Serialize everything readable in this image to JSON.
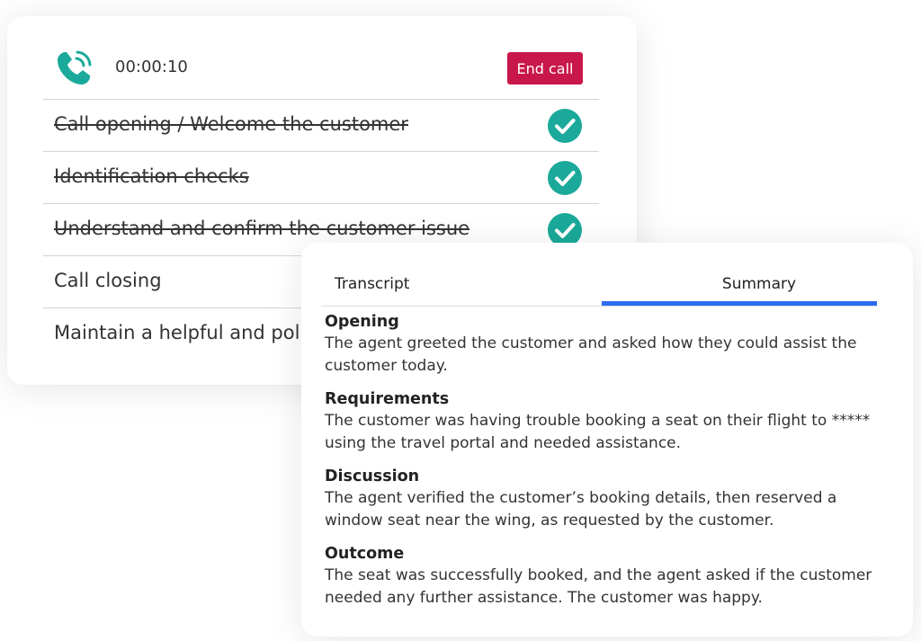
{
  "call": {
    "timer": "00:00:10",
    "end_call_label": "End call",
    "icons": {
      "phone": "phone-ringing-icon",
      "check": "check-circle-icon"
    },
    "accent_color": "#1aa99a",
    "end_call_color": "#c8174a",
    "checklist": [
      {
        "label": "Call opening / Welcome the customer",
        "done": true
      },
      {
        "label": "Identification checks",
        "done": true
      },
      {
        "label": "Understand and confirm the customer issue",
        "done": true
      },
      {
        "label": "Call closing",
        "done": false
      },
      {
        "label": "Maintain a helpful and polite",
        "done": false
      }
    ]
  },
  "summary_panel": {
    "tabs": [
      {
        "label": "Transcript",
        "active": false
      },
      {
        "label": "Summary",
        "active": true
      }
    ],
    "active_tab_color": "#2d6cf0",
    "sections": [
      {
        "title": "Opening",
        "text": "The agent greeted the customer and asked how they could assist the customer today."
      },
      {
        "title": "Requirements",
        "text": "The customer was having trouble booking a seat on their flight to ***** using the travel portal and needed assistance."
      },
      {
        "title": "Discussion",
        "text": "The agent verified the customer’s booking details, then reserved a window seat near the wing, as requested by the customer."
      },
      {
        "title": "Outcome",
        "text": "The seat was successfully booked, and the agent asked if the customer needed any further assistance. The customer was happy."
      }
    ]
  }
}
